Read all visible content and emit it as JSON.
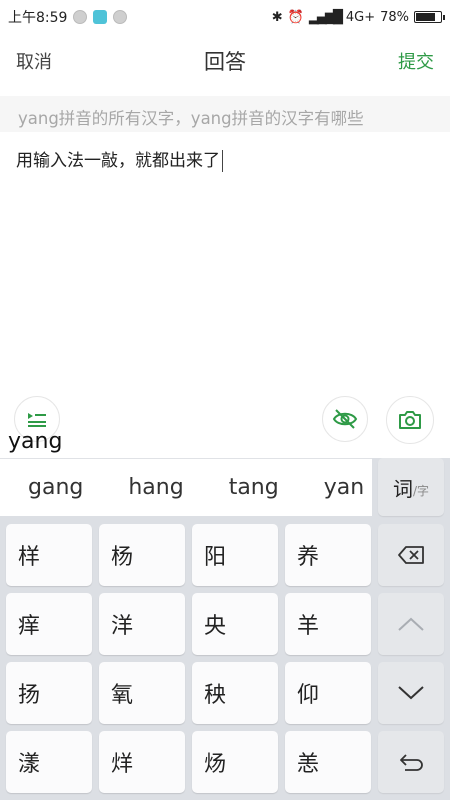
{
  "status_bar": {
    "time": "上午8:59",
    "network": "4G+",
    "battery": "78%",
    "battery_level": 0.78
  },
  "nav": {
    "cancel": "取消",
    "title": "回答",
    "submit": "提交"
  },
  "question": {
    "text": "yang拼音的所有汉字，yang拼音的汉字有哪些"
  },
  "answer": {
    "text": "用输入法一敲，就都出来了"
  },
  "toolbar": {
    "icons": [
      "list-icon",
      "eye-off-icon",
      "camera-icon"
    ]
  },
  "ime": {
    "typed": "yang",
    "candidates": [
      "gang",
      "hang",
      "tang",
      "yan"
    ],
    "mode": {
      "main": "词",
      "sub": "/字"
    },
    "keys": [
      [
        "样",
        "杨",
        "阳",
        "养"
      ],
      [
        "痒",
        "洋",
        "央",
        "羊"
      ],
      [
        "扬",
        "氧",
        "秧",
        "仰"
      ],
      [
        "漾",
        "烊",
        "炀",
        "恙"
      ]
    ]
  },
  "colors": {
    "accent": "#2e9a46",
    "placeholder": "#a7a7a7",
    "keyboard_bg": "#dcdfe4"
  }
}
